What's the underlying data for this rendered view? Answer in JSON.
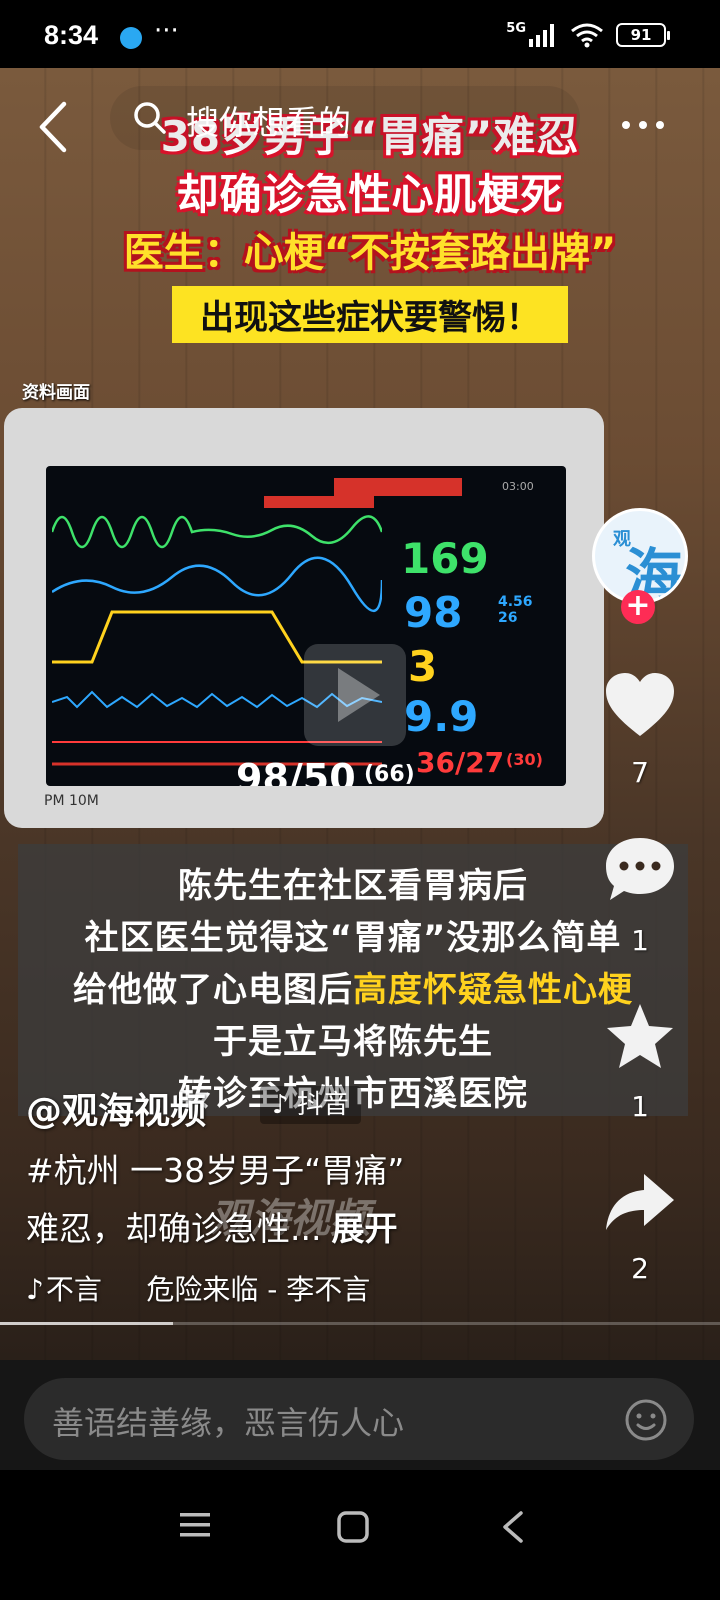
{
  "status_bar": {
    "time": "8:34",
    "more": "···",
    "network": "5G",
    "battery": "91"
  },
  "search": {
    "placeholder": "搜你想看的"
  },
  "video": {
    "headline": {
      "line1": "38岁男子“胃痛”难忍",
      "line2": "却确诊急性心肌梗死",
      "line3": "医生：心梗“不按套路出牌”",
      "line4": "出现这些症状要警惕！"
    },
    "source_label": "资料画面",
    "monitor": {
      "heart_rate": "169",
      "spo2": "98",
      "resp": "3",
      "etco2": "9.9",
      "abp": "36/27",
      "abp_mean": "(30)",
      "spo2_side": "4.56",
      "spo2_side2": "26",
      "nibp": "98/50",
      "nibp_mean": "(66)",
      "timestamp": "03:00",
      "bottom_label": "PM 10M"
    },
    "caption": {
      "line1": "陈先生在社区看胃病后",
      "line2": "社区医生觉得这“胃痛”没那么简单",
      "line3_plain": "给他做了心电图后",
      "line3_highlight": "高度怀疑急性心梗",
      "line4": "于是立马将陈先生",
      "line5": "转诊至杭州市西溪医院"
    },
    "watermark": "观海视频"
  },
  "actions": {
    "avatar_small": "观",
    "avatar_big": "海",
    "follow": "+",
    "likes": "7",
    "comments": "1",
    "favorites": "1",
    "shares": "2"
  },
  "info": {
    "author": "@观海视频",
    "platform_tag": "抖音",
    "description_line1": "#杭州 一38岁男子“胃痛”",
    "description_line2": "难忍，却确诊急性...",
    "expand": "展开",
    "music_author": "不言",
    "music_title": "危险来临 - 李不言",
    "progress": 0.24
  },
  "comment_bar": {
    "placeholder": "善语结善缘，恶言伤人心"
  },
  "colors": {
    "accent": "#fe2c55",
    "headline_red": "#d8132b",
    "headline_yellow": "#fde322",
    "caption_highlight": "#ffd21e"
  }
}
